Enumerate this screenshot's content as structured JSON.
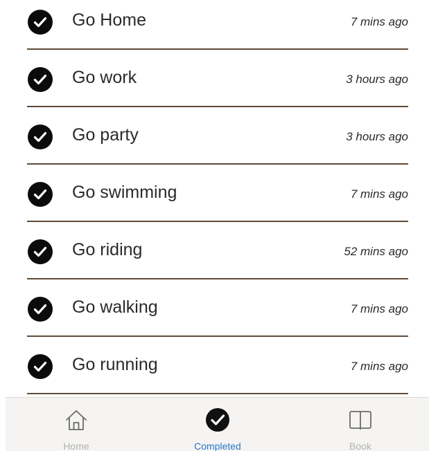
{
  "tasks": [
    {
      "title": "Go Home",
      "time": "7 mins ago"
    },
    {
      "title": "Go work",
      "time": "3 hours ago"
    },
    {
      "title": "Go party",
      "time": "3 hours ago"
    },
    {
      "title": "Go swimming",
      "time": "7 mins ago"
    },
    {
      "title": "Go riding",
      "time": "52 mins ago"
    },
    {
      "title": "Go walking",
      "time": "7 mins ago"
    },
    {
      "title": "Go running",
      "time": "7 mins ago"
    }
  ],
  "tabbar": {
    "tabs": [
      {
        "label": "Home",
        "icon": "home-icon",
        "active": false
      },
      {
        "label": "Completed",
        "icon": "check-circle-icon",
        "active": true
      },
      {
        "label": "Book",
        "icon": "book-icon",
        "active": false
      }
    ]
  },
  "colors": {
    "check": "#0b0b0b",
    "divider": "#5e4a38",
    "active_tab": "#2c74c6",
    "inactive_tab": "#b0b0b0",
    "tabbar_bg": "#f5f4f2"
  }
}
